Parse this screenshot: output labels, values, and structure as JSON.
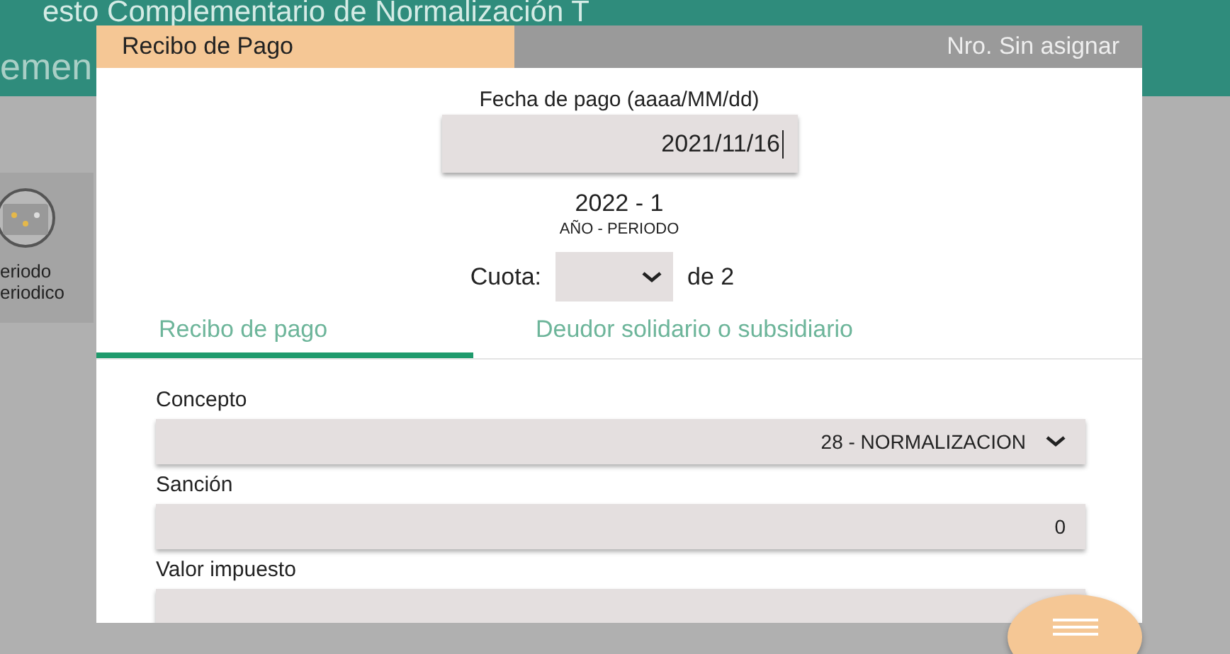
{
  "background": {
    "title": "esto Complementario de Normalización T",
    "subtitle": "emen",
    "card_lines": [
      "eriodo",
      "eriodico"
    ]
  },
  "dialog": {
    "title": "Recibo de Pago",
    "number": "Nro. Sin asignar",
    "date_label": "Fecha de pago (aaaa/MM/dd)",
    "date_value": "2021/11/16",
    "period": "2022 - 1",
    "period_caption": "AÑO - PERIODO",
    "cuota_label": "Cuota:",
    "cuota_of": "de 2",
    "tabs": [
      {
        "label": "Recibo de pago",
        "selected": true
      },
      {
        "label": "Deudor solidario o subsidiario",
        "selected": false
      }
    ],
    "fields": [
      {
        "label": "Concepto",
        "kind": "select",
        "value": "28 - NORMALIZACION"
      },
      {
        "label": "Sanción",
        "kind": "input",
        "value": "0"
      },
      {
        "label": "Valor impuesto",
        "kind": "input"
      }
    ]
  }
}
